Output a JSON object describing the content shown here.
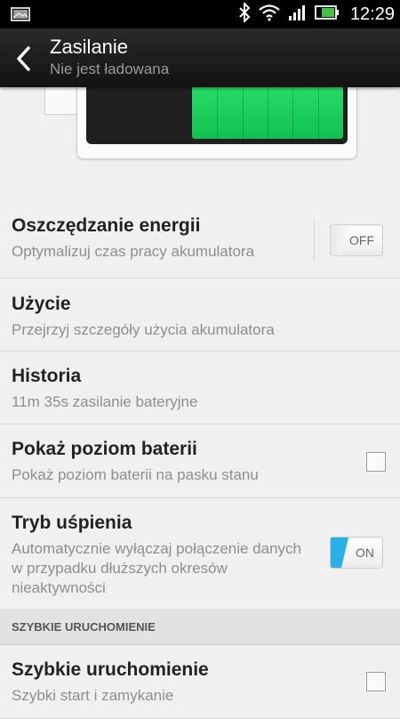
{
  "status_bar": {
    "time": "12:29",
    "icons": [
      "notification-image-icon",
      "bluetooth-icon",
      "wifi-icon",
      "signal-icon",
      "battery-icon"
    ],
    "battery_color": "#3fc63f"
  },
  "action_bar": {
    "title": "Zasilanie",
    "subtitle": "Nie jest ładowana",
    "back_icon": "back-arrow-icon"
  },
  "battery_graphic": {
    "fill_fraction": 0.6,
    "fill_color": "#12c050"
  },
  "settings": [
    {
      "title": "Oszczędzanie energii",
      "subtitle": "Optymalizuj czas pracy akumulatora",
      "control": "toggle",
      "state": "OFF"
    },
    {
      "title": "Użycie",
      "subtitle": "Przejrzyj szczegóły użycia akumulatora"
    },
    {
      "title": "Historia",
      "subtitle": "11m 35s zasilanie bateryjne"
    },
    {
      "title": "Pokaż poziom baterii",
      "subtitle": "Pokaż poziom baterii na pasku stanu",
      "control": "checkbox",
      "checked": false
    },
    {
      "title": "Tryb uśpienia",
      "subtitle": "Automatycznie wyłączaj połączenie danych w przypadku dłuższych okresów nieaktywności",
      "control": "toggle",
      "state": "ON"
    }
  ],
  "section_header": "SZYBKIE URUCHOMIENIE",
  "quick_boot": {
    "title": "Szybkie uruchomienie",
    "subtitle": "Szybki start i zamykanie",
    "control": "checkbox",
    "checked": false
  },
  "colors": {
    "toggle_on_accent": "#2ab0e8"
  }
}
